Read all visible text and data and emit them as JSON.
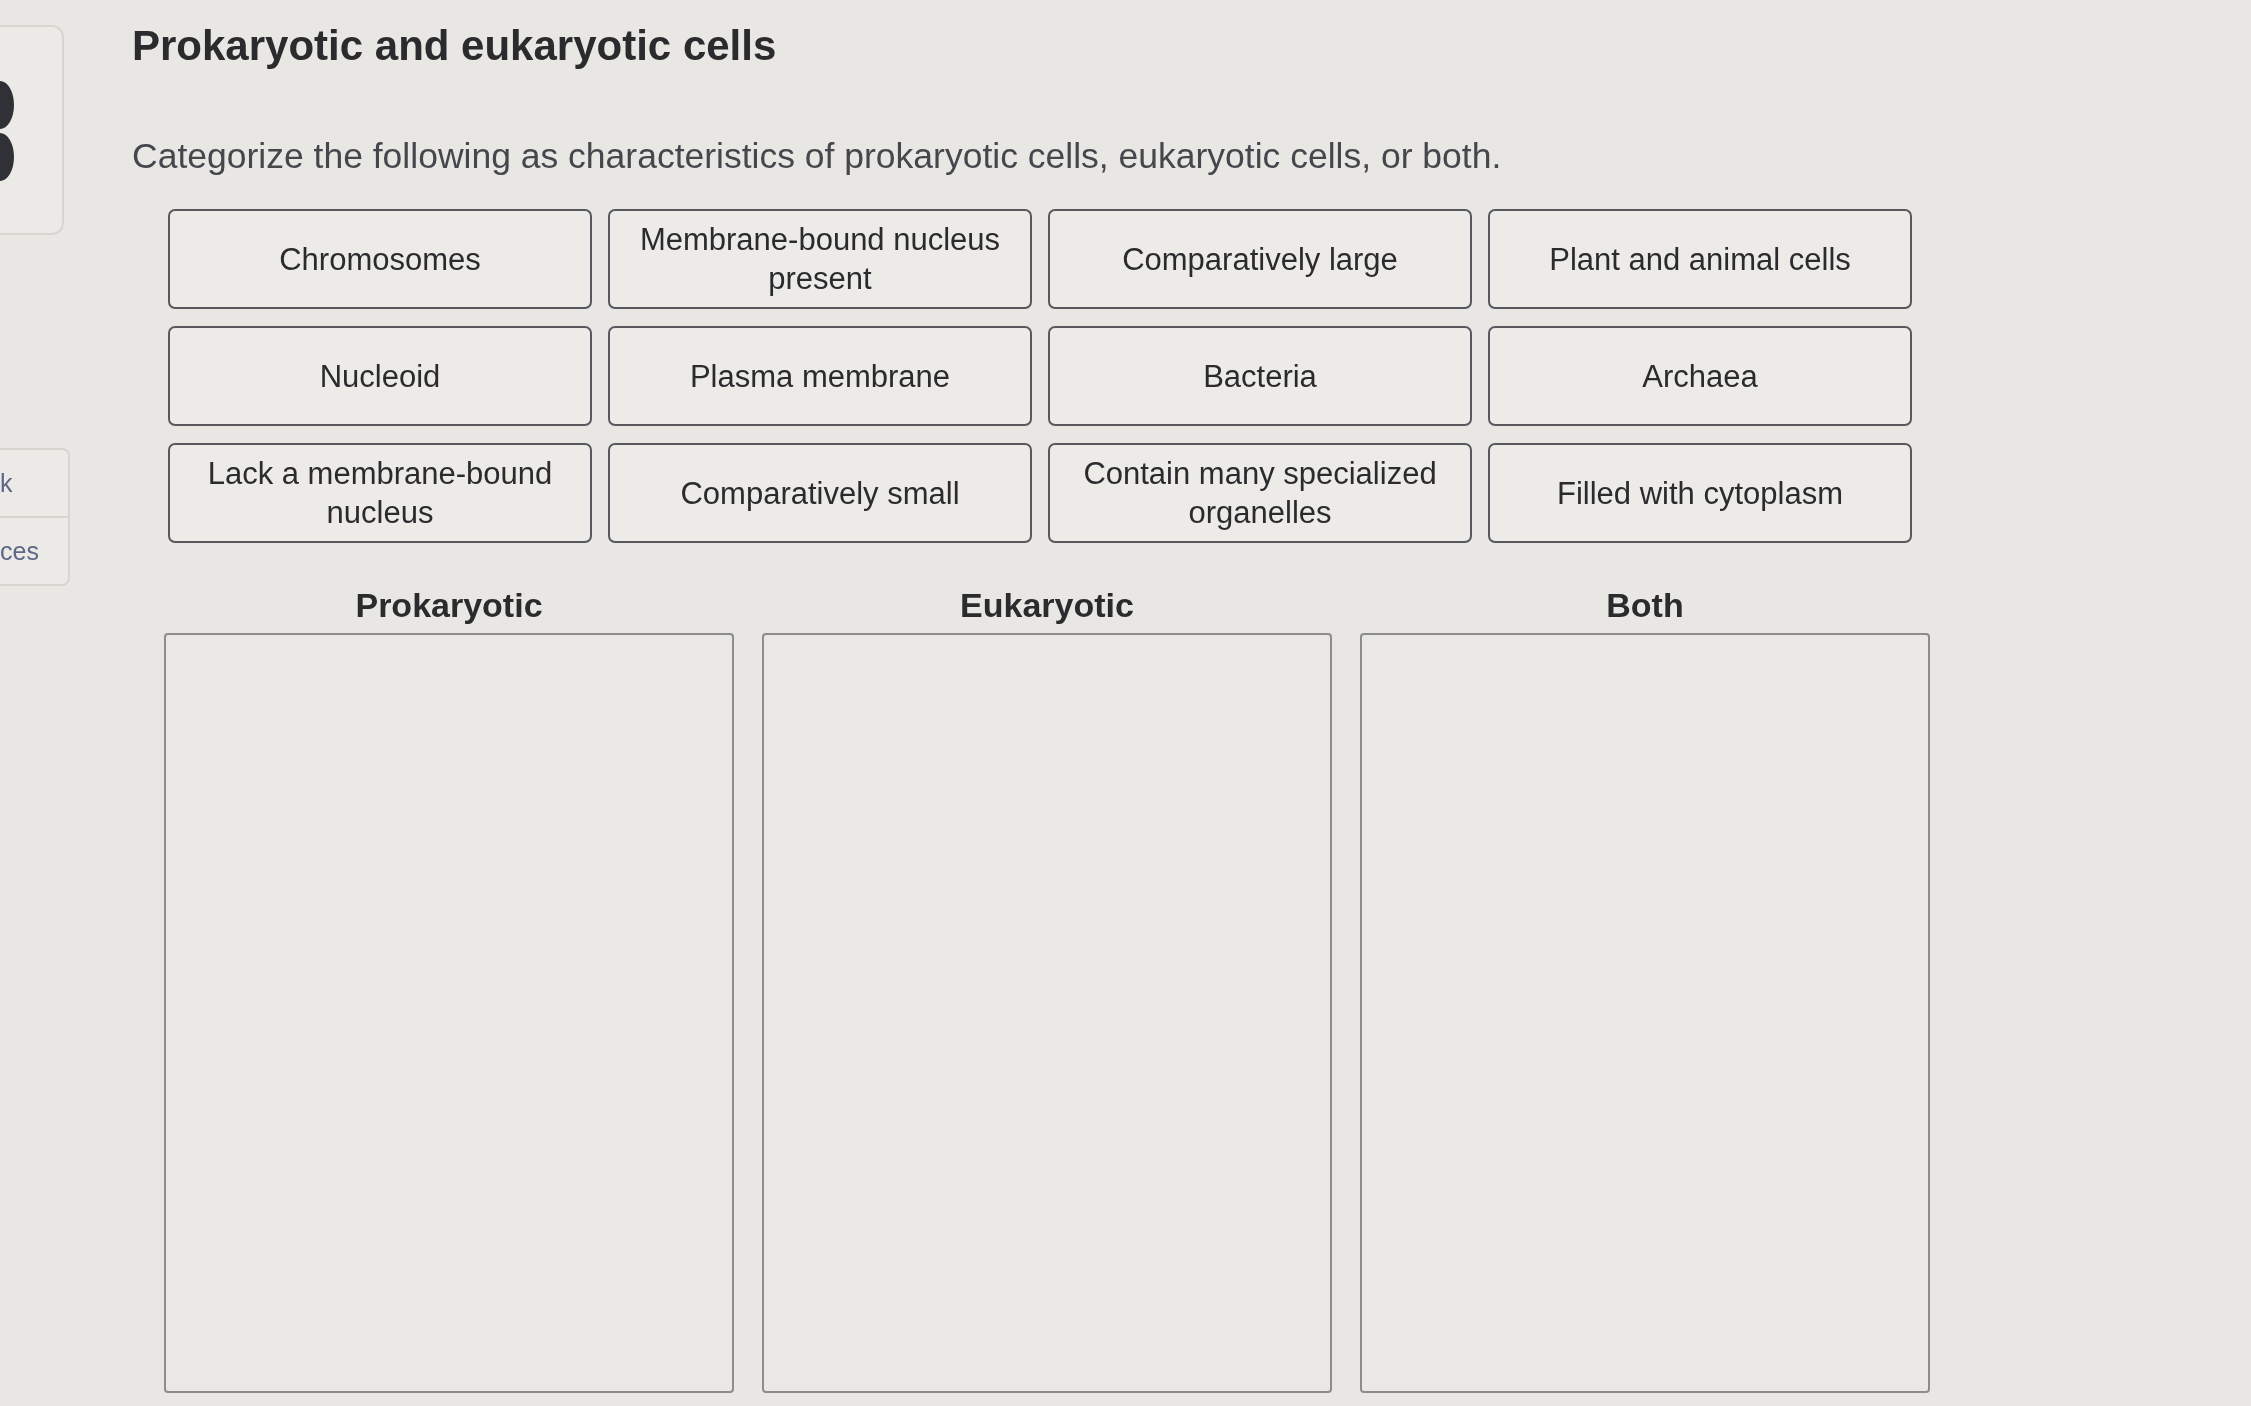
{
  "sidebar": {
    "links": [
      {
        "label": "k"
      },
      {
        "label": "ces"
      }
    ]
  },
  "title": "Prokaryotic and eukaryotic cells",
  "instructions": "Categorize the following as characteristics of prokaryotic cells, eukaryotic cells, or both.",
  "answer_tiles": [
    {
      "label": "Chromosomes"
    },
    {
      "label": "Membrane-bound nucleus present"
    },
    {
      "label": "Comparatively large"
    },
    {
      "label": "Plant and animal cells"
    },
    {
      "label": "Nucleoid"
    },
    {
      "label": "Plasma membrane"
    },
    {
      "label": "Bacteria"
    },
    {
      "label": "Archaea"
    },
    {
      "label": "Lack a membrane-bound nucleus"
    },
    {
      "label": "Comparatively small"
    },
    {
      "label": "Contain many specialized organelles"
    },
    {
      "label": "Filled with cytoplasm"
    }
  ],
  "categories": [
    {
      "label": "Prokaryotic"
    },
    {
      "label": "Eukaryotic"
    },
    {
      "label": "Both"
    }
  ]
}
